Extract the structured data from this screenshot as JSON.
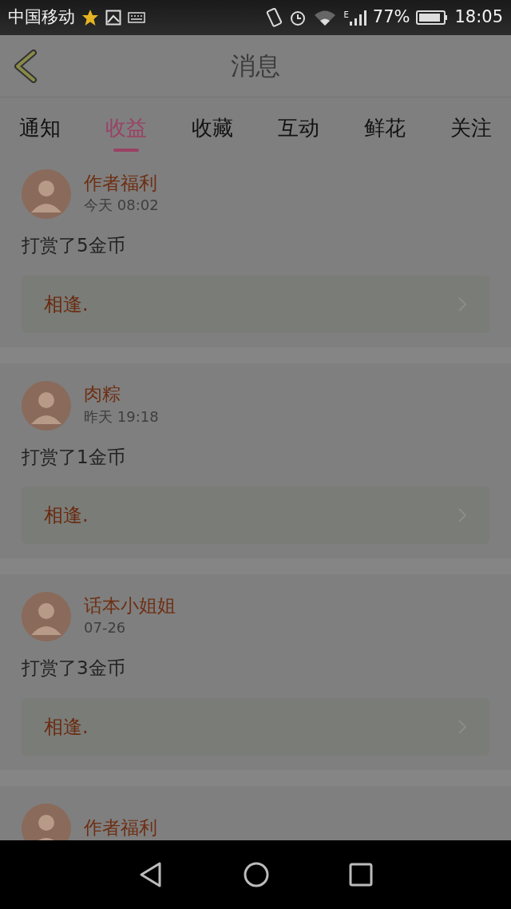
{
  "status_bar": {
    "carrier": "中国移动",
    "network_type": "E",
    "battery": "77%",
    "time": "18:05"
  },
  "header": {
    "title": "消息"
  },
  "tabs": [
    {
      "label": "通知",
      "selected": false
    },
    {
      "label": "收益",
      "selected": true
    },
    {
      "label": "收藏",
      "selected": false
    },
    {
      "label": "互动",
      "selected": false
    },
    {
      "label": "鲜花",
      "selected": false
    },
    {
      "label": "关注",
      "selected": false
    }
  ],
  "messages": [
    {
      "sender": "作者福利",
      "time": "今天 08:02",
      "text": "打赏了5金币",
      "link": "相逢."
    },
    {
      "sender": "肉粽",
      "time": "昨天 19:18",
      "text": "打赏了1金币",
      "link": "相逢."
    },
    {
      "sender": "话本小姐姐",
      "time": "07-26",
      "text": "打赏了3金币",
      "link": "相逢."
    },
    {
      "sender": "作者福利"
    }
  ]
}
